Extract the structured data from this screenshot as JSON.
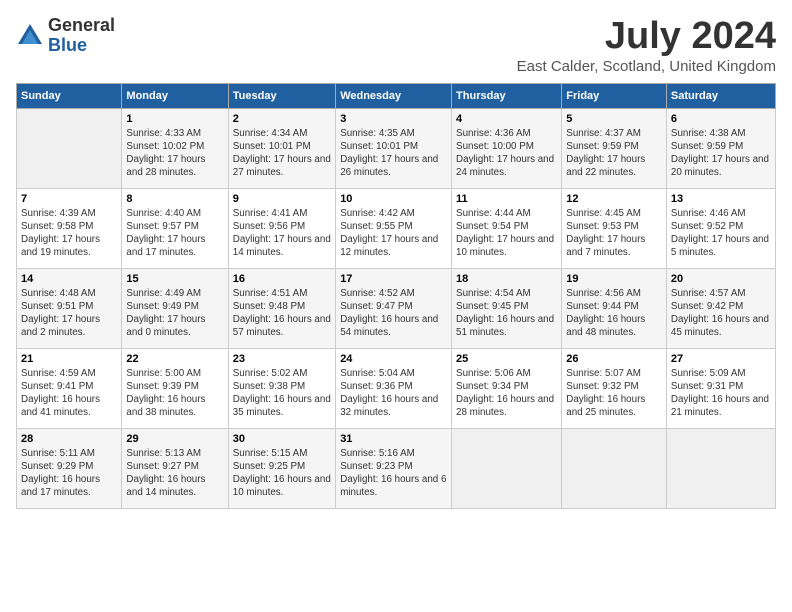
{
  "logo": {
    "general": "General",
    "blue": "Blue"
  },
  "title": "July 2024",
  "location": "East Calder, Scotland, United Kingdom",
  "days_header": [
    "Sunday",
    "Monday",
    "Tuesday",
    "Wednesday",
    "Thursday",
    "Friday",
    "Saturday"
  ],
  "weeks": [
    [
      {
        "num": "",
        "sunrise": "",
        "sunset": "",
        "daylight": ""
      },
      {
        "num": "1",
        "sunrise": "Sunrise: 4:33 AM",
        "sunset": "Sunset: 10:02 PM",
        "daylight": "Daylight: 17 hours and 28 minutes."
      },
      {
        "num": "2",
        "sunrise": "Sunrise: 4:34 AM",
        "sunset": "Sunset: 10:01 PM",
        "daylight": "Daylight: 17 hours and 27 minutes."
      },
      {
        "num": "3",
        "sunrise": "Sunrise: 4:35 AM",
        "sunset": "Sunset: 10:01 PM",
        "daylight": "Daylight: 17 hours and 26 minutes."
      },
      {
        "num": "4",
        "sunrise": "Sunrise: 4:36 AM",
        "sunset": "Sunset: 10:00 PM",
        "daylight": "Daylight: 17 hours and 24 minutes."
      },
      {
        "num": "5",
        "sunrise": "Sunrise: 4:37 AM",
        "sunset": "Sunset: 9:59 PM",
        "daylight": "Daylight: 17 hours and 22 minutes."
      },
      {
        "num": "6",
        "sunrise": "Sunrise: 4:38 AM",
        "sunset": "Sunset: 9:59 PM",
        "daylight": "Daylight: 17 hours and 20 minutes."
      }
    ],
    [
      {
        "num": "7",
        "sunrise": "Sunrise: 4:39 AM",
        "sunset": "Sunset: 9:58 PM",
        "daylight": "Daylight: 17 hours and 19 minutes."
      },
      {
        "num": "8",
        "sunrise": "Sunrise: 4:40 AM",
        "sunset": "Sunset: 9:57 PM",
        "daylight": "Daylight: 17 hours and 17 minutes."
      },
      {
        "num": "9",
        "sunrise": "Sunrise: 4:41 AM",
        "sunset": "Sunset: 9:56 PM",
        "daylight": "Daylight: 17 hours and 14 minutes."
      },
      {
        "num": "10",
        "sunrise": "Sunrise: 4:42 AM",
        "sunset": "Sunset: 9:55 PM",
        "daylight": "Daylight: 17 hours and 12 minutes."
      },
      {
        "num": "11",
        "sunrise": "Sunrise: 4:44 AM",
        "sunset": "Sunset: 9:54 PM",
        "daylight": "Daylight: 17 hours and 10 minutes."
      },
      {
        "num": "12",
        "sunrise": "Sunrise: 4:45 AM",
        "sunset": "Sunset: 9:53 PM",
        "daylight": "Daylight: 17 hours and 7 minutes."
      },
      {
        "num": "13",
        "sunrise": "Sunrise: 4:46 AM",
        "sunset": "Sunset: 9:52 PM",
        "daylight": "Daylight: 17 hours and 5 minutes."
      }
    ],
    [
      {
        "num": "14",
        "sunrise": "Sunrise: 4:48 AM",
        "sunset": "Sunset: 9:51 PM",
        "daylight": "Daylight: 17 hours and 2 minutes."
      },
      {
        "num": "15",
        "sunrise": "Sunrise: 4:49 AM",
        "sunset": "Sunset: 9:49 PM",
        "daylight": "Daylight: 17 hours and 0 minutes."
      },
      {
        "num": "16",
        "sunrise": "Sunrise: 4:51 AM",
        "sunset": "Sunset: 9:48 PM",
        "daylight": "Daylight: 16 hours and 57 minutes."
      },
      {
        "num": "17",
        "sunrise": "Sunrise: 4:52 AM",
        "sunset": "Sunset: 9:47 PM",
        "daylight": "Daylight: 16 hours and 54 minutes."
      },
      {
        "num": "18",
        "sunrise": "Sunrise: 4:54 AM",
        "sunset": "Sunset: 9:45 PM",
        "daylight": "Daylight: 16 hours and 51 minutes."
      },
      {
        "num": "19",
        "sunrise": "Sunrise: 4:56 AM",
        "sunset": "Sunset: 9:44 PM",
        "daylight": "Daylight: 16 hours and 48 minutes."
      },
      {
        "num": "20",
        "sunrise": "Sunrise: 4:57 AM",
        "sunset": "Sunset: 9:42 PM",
        "daylight": "Daylight: 16 hours and 45 minutes."
      }
    ],
    [
      {
        "num": "21",
        "sunrise": "Sunrise: 4:59 AM",
        "sunset": "Sunset: 9:41 PM",
        "daylight": "Daylight: 16 hours and 41 minutes."
      },
      {
        "num": "22",
        "sunrise": "Sunrise: 5:00 AM",
        "sunset": "Sunset: 9:39 PM",
        "daylight": "Daylight: 16 hours and 38 minutes."
      },
      {
        "num": "23",
        "sunrise": "Sunrise: 5:02 AM",
        "sunset": "Sunset: 9:38 PM",
        "daylight": "Daylight: 16 hours and 35 minutes."
      },
      {
        "num": "24",
        "sunrise": "Sunrise: 5:04 AM",
        "sunset": "Sunset: 9:36 PM",
        "daylight": "Daylight: 16 hours and 32 minutes."
      },
      {
        "num": "25",
        "sunrise": "Sunrise: 5:06 AM",
        "sunset": "Sunset: 9:34 PM",
        "daylight": "Daylight: 16 hours and 28 minutes."
      },
      {
        "num": "26",
        "sunrise": "Sunrise: 5:07 AM",
        "sunset": "Sunset: 9:32 PM",
        "daylight": "Daylight: 16 hours and 25 minutes."
      },
      {
        "num": "27",
        "sunrise": "Sunrise: 5:09 AM",
        "sunset": "Sunset: 9:31 PM",
        "daylight": "Daylight: 16 hours and 21 minutes."
      }
    ],
    [
      {
        "num": "28",
        "sunrise": "Sunrise: 5:11 AM",
        "sunset": "Sunset: 9:29 PM",
        "daylight": "Daylight: 16 hours and 17 minutes."
      },
      {
        "num": "29",
        "sunrise": "Sunrise: 5:13 AM",
        "sunset": "Sunset: 9:27 PM",
        "daylight": "Daylight: 16 hours and 14 minutes."
      },
      {
        "num": "30",
        "sunrise": "Sunrise: 5:15 AM",
        "sunset": "Sunset: 9:25 PM",
        "daylight": "Daylight: 16 hours and 10 minutes."
      },
      {
        "num": "31",
        "sunrise": "Sunrise: 5:16 AM",
        "sunset": "Sunset: 9:23 PM",
        "daylight": "Daylight: 16 hours and 6 minutes."
      },
      {
        "num": "",
        "sunrise": "",
        "sunset": "",
        "daylight": ""
      },
      {
        "num": "",
        "sunrise": "",
        "sunset": "",
        "daylight": ""
      },
      {
        "num": "",
        "sunrise": "",
        "sunset": "",
        "daylight": ""
      }
    ]
  ]
}
